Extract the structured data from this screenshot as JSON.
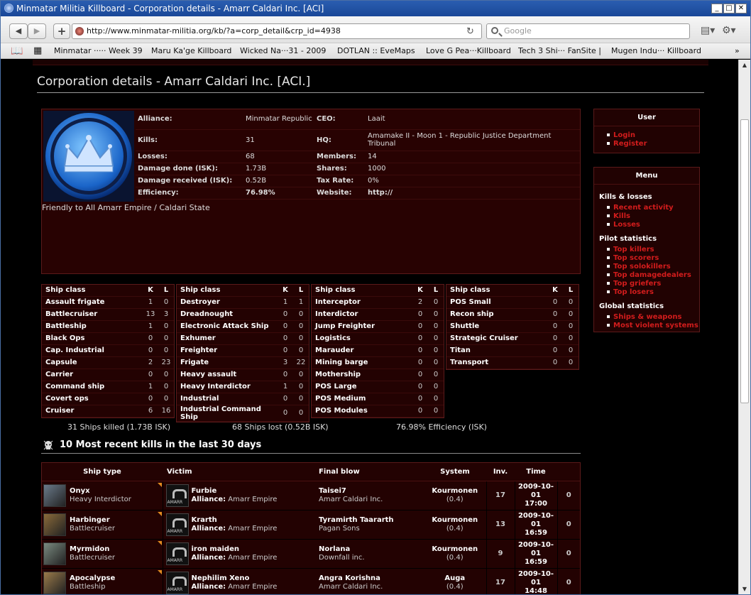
{
  "window": {
    "title": "Minmatar Militia Killboard - Corporation details - Amarr Caldari Inc. [ACI]"
  },
  "browser": {
    "url": "http://www.minmatar-militia.org/kb/?a=corp_detail&crp_id=4938",
    "search_placeholder": "Google",
    "bookmarks": [
      "Minmatar ····· Week 39",
      "Maru Ka'ge Killboard",
      "Wicked Na···31 - 2009",
      "DOTLAN :: EveMaps",
      "Love G Pea···Killboard",
      "Tech 3 Shi··· FanSite |",
      "Mugen Indu··· Killboard"
    ]
  },
  "page": {
    "title": "Corporation details - Amarr Caldari Inc. [ACI.]"
  },
  "corp": {
    "labels": {
      "alliance": "Alliance:",
      "kills": "Kills:",
      "losses": "Losses:",
      "damage_done": "Damage done (ISK):",
      "damage_received": "Damage received (ISK):",
      "efficiency": "Efficiency:",
      "ceo": "CEO:",
      "hq": "HQ:",
      "members": "Members:",
      "shares": "Shares:",
      "tax": "Tax Rate:",
      "website": "Website:"
    },
    "alliance": "Minmatar Republic",
    "kills": "31",
    "losses": "68",
    "damage_done": "1.73B",
    "damage_received": "0.52B",
    "efficiency": "76.98%",
    "ceo": "Laait",
    "hq": "Amamake II - Moon 1 - Republic Justice Department Tribunal",
    "members": "14",
    "shares": "1000",
    "tax": "0%",
    "website": "http://",
    "description": "Friendly to All Amarr Empire / Caldari State"
  },
  "sidebar": {
    "user_header": "User",
    "user_links": [
      "Login",
      "Register"
    ],
    "menu_header": "Menu",
    "sections": [
      {
        "title": "Kills & losses",
        "links": [
          "Recent activity",
          "Kills",
          "Losses"
        ]
      },
      {
        "title": "Pilot statistics",
        "links": [
          "Top killers",
          "Top scorers",
          "Top solokillers",
          "Top damagedealers",
          "Top griefers",
          "Top losers"
        ]
      },
      {
        "title": "Global statistics",
        "links": [
          "Ships & weapons",
          "Most violent systems"
        ]
      }
    ]
  },
  "shipclass": {
    "headers": {
      "cls": "Ship class",
      "k": "K",
      "l": "L"
    },
    "tables": [
      [
        [
          "Assault frigate",
          "1",
          "0"
        ],
        [
          "Battlecruiser",
          "13",
          "3"
        ],
        [
          "Battleship",
          "1",
          "0"
        ],
        [
          "Black Ops",
          "0",
          "0"
        ],
        [
          "Cap. Industrial",
          "0",
          "0"
        ],
        [
          "Capsule",
          "2",
          "23"
        ],
        [
          "Carrier",
          "0",
          "0"
        ],
        [
          "Command ship",
          "1",
          "0"
        ],
        [
          "Covert ops",
          "0",
          "0"
        ],
        [
          "Cruiser",
          "6",
          "16"
        ]
      ],
      [
        [
          "Destroyer",
          "1",
          "1"
        ],
        [
          "Dreadnought",
          "0",
          "0"
        ],
        [
          "Electronic Attack Ship",
          "0",
          "0"
        ],
        [
          "Exhumer",
          "0",
          "0"
        ],
        [
          "Freighter",
          "0",
          "0"
        ],
        [
          "Frigate",
          "3",
          "22"
        ],
        [
          "Heavy assault",
          "0",
          "0"
        ],
        [
          "Heavy Interdictor",
          "1",
          "0"
        ],
        [
          "Industrial",
          "0",
          "0"
        ],
        [
          "Industrial Command Ship",
          "0",
          "0"
        ]
      ],
      [
        [
          "Interceptor",
          "2",
          "0"
        ],
        [
          "Interdictor",
          "0",
          "0"
        ],
        [
          "Jump Freighter",
          "0",
          "0"
        ],
        [
          "Logistics",
          "0",
          "0"
        ],
        [
          "Marauder",
          "0",
          "0"
        ],
        [
          "Mining barge",
          "0",
          "0"
        ],
        [
          "Mothership",
          "0",
          "0"
        ],
        [
          "POS Large",
          "0",
          "0"
        ],
        [
          "POS Medium",
          "0",
          "0"
        ],
        [
          "POS Modules",
          "0",
          "0"
        ]
      ],
      [
        [
          "POS Small",
          "0",
          "0"
        ],
        [
          "Recon ship",
          "0",
          "0"
        ],
        [
          "Shuttle",
          "0",
          "0"
        ],
        [
          "Strategic Cruiser",
          "0",
          "0"
        ],
        [
          "Titan",
          "0",
          "0"
        ],
        [
          "Transport",
          "0",
          "0"
        ]
      ]
    ]
  },
  "summary": {
    "killed": "31 Ships killed (1.73B ISK)",
    "lost": "68 Ships lost (0.52B ISK)",
    "efficiency": "76.98% Efficiency (ISK)"
  },
  "recent": {
    "title": "10 Most recent kills in the last 30 days",
    "headers": [
      "Ship type",
      "Victim",
      "Final blow",
      "System",
      "Inv.",
      "Time"
    ],
    "alliance_label": "Alliance:",
    "rows": [
      {
        "ship": "Onyx",
        "class": "Heavy Interdictor",
        "victim": "Furbie",
        "alliance": "Amarr Empire",
        "fb": "Taisei7",
        "fbcorp": "Amarr Caldari Inc.",
        "system": "Kourmonen",
        "sec": "(0.4)",
        "inv": "17",
        "date": "2009-10-01",
        "time": "17:00",
        "extra": "0",
        "color": "#6a7a8a"
      },
      {
        "ship": "Harbinger",
        "class": "Battlecruiser",
        "victim": "Krarth",
        "alliance": "Amarr Empire",
        "fb": "Tyramirth Taararth",
        "fbcorp": "Pagan Sons",
        "system": "Kourmonen",
        "sec": "(0.4)",
        "inv": "13",
        "date": "2009-10-01",
        "time": "16:59",
        "extra": "0",
        "color": "#8a6a3a"
      },
      {
        "ship": "Myrmidon",
        "class": "Battlecruiser",
        "victim": "iron maiden",
        "alliance": "Amarr Empire",
        "fb": "Norlana",
        "fbcorp": "Downfall inc.",
        "system": "Kourmonen",
        "sec": "(0.4)",
        "inv": "9",
        "date": "2009-10-01",
        "time": "16:59",
        "extra": "0",
        "color": "#7a8a80"
      },
      {
        "ship": "Apocalypse",
        "class": "Battleship",
        "victim": "Nephilim Xeno",
        "alliance": "Amarr Empire",
        "fb": "Angra Korishna",
        "fbcorp": "Amarr Caldari Inc.",
        "system": "Auga",
        "sec": "(0.4)",
        "inv": "17",
        "date": "2009-10-01",
        "time": "14:48",
        "extra": "0",
        "color": "#9a7a4a"
      }
    ]
  }
}
